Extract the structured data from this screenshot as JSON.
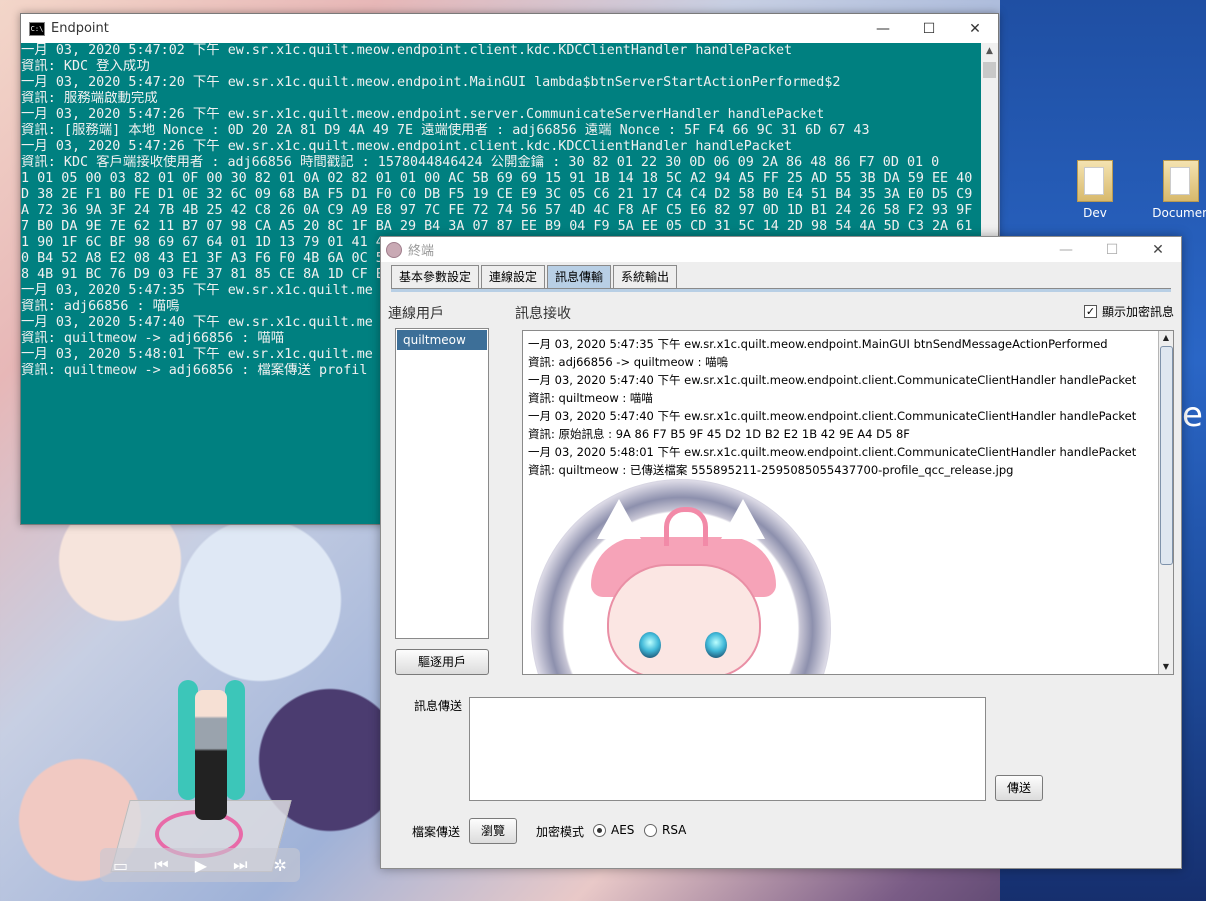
{
  "console": {
    "title": "Endpoint",
    "lines": [
      "一月 03, 2020 5:47:02 下午 ew.sr.x1c.quilt.meow.endpoint.client.kdc.KDCClientHandler handlePacket",
      "資訊: KDC 登入成功",
      "一月 03, 2020 5:47:20 下午 ew.sr.x1c.quilt.meow.endpoint.MainGUI lambda$btnServerStartActionPerformed$2",
      "資訊: 服務端啟動完成",
      "一月 03, 2020 5:47:26 下午 ew.sr.x1c.quilt.meow.endpoint.server.CommunicateServerHandler handlePacket",
      "資訊: [服務端] 本地 Nonce : 0D 20 2A 81 D9 4A 49 7E 遠端使用者 : adj66856 遠端 Nonce : 5F F4 66 9C 31 6D 67 43",
      "一月 03, 2020 5:47:26 下午 ew.sr.x1c.quilt.meow.endpoint.client.kdc.KDCClientHandler handlePacket",
      "資訊: KDC 客戶端接收使用者 : adj66856 時間戳記 : 1578044846424 公開金鑰 : 30 82 01 22 30 0D 06 09 2A 86 48 86 F7 0D 01 0",
      "1 01 05 00 03 82 01 0F 00 30 82 01 0A 02 82 01 01 00 AC 5B 69 69 15 91 1B 14 18 5C A2 94 A5 FF 25 AD 55 3B DA 59 EE 40 7",
      "D 38 2E F1 B0 FE D1 0E 32 6C 09 68 BA F5 D1 F0 C0 DB F5 19 CE E9 3C 05 C6 21 17 C4 C4 D2 58 B0 E4 51 B4 35 3A E0 D5 C9 D",
      "A 72 36 9A 3F 24 7B 4B 25 42 C8 26 0A C9 A9 E8 97 7C FE 72 74 56 57 4D 4C F8 AF C5 E6 82 97 0D 1D B1 24 26 58 F2 93 9F 1",
      "7 B0 DA 9E 7E 62 11 B7 07 98 CA A5 20 8C 1F BA 29 B4 3A 07 87 EE B9 04 F9 5A EE 05 CD 31 5C 14 2D 98 54 4A 5D C3 2A 61 8",
      "1 90 1F 6C BF 98 69 67 64 01 1D 13 79 01 41 4",
      "0 B4 52 A8 E2 08 43 E1 3F A3 F6 F0 4B 6A 0C 5",
      "8 4B 91 BC 76 D9 03 FE 37 81 85 CE 8A 1D CF E",
      "一月 03, 2020 5:47:35 下午 ew.sr.x1c.quilt.me",
      "資訊: adj66856 : 喵嗚",
      "一月 03, 2020 5:47:40 下午 ew.sr.x1c.quilt.me",
      "資訊: quiltmeow -> adj66856 : 喵喵",
      "一月 03, 2020 5:48:01 下午 ew.sr.x1c.quilt.me",
      "資訊: quiltmeow -> adj66856 : 檔案傳送 profil"
    ]
  },
  "desktop": {
    "icons": [
      "Dev",
      "Documen"
    ],
    "partial_text": "e"
  },
  "window": {
    "title": "終端",
    "tabs": [
      "基本參數設定",
      "連線設定",
      "訊息傳輸",
      "系統輸出"
    ],
    "active_tab": "訊息傳輸",
    "users_label": "連線用戶",
    "users": [
      "quiltmeow"
    ],
    "kick_button": "驅逐用戶",
    "receive_label": "訊息接收",
    "show_encrypted_label": "顯示加密訊息",
    "show_encrypted_checked": true,
    "messages": [
      "一月 03, 2020 5:47:35 下午 ew.sr.x1c.quilt.meow.endpoint.MainGUI btnSendMessageActionPerformed",
      "資訊: adj66856 -> quiltmeow : 喵嗚",
      "一月 03, 2020 5:47:40 下午 ew.sr.x1c.quilt.meow.endpoint.client.CommunicateClientHandler handlePacket",
      "資訊: quiltmeow : 喵喵",
      "一月 03, 2020 5:47:40 下午 ew.sr.x1c.quilt.meow.endpoint.client.CommunicateClientHandler handlePacket",
      "資訊: 原始訊息 : 9A 86 F7 B5 9F 45 D2 1D B2 E2 1B 42 9E A4 D5 8F",
      "一月 03, 2020 5:48:01 下午 ew.sr.x1c.quilt.meow.endpoint.client.CommunicateClientHandler handlePacket",
      "資訊: quiltmeow : 已傳送檔案 555895211-2595085055437700-profile_qcc_release.jpg"
    ],
    "send_label": "訊息傳送",
    "send_button": "傳送",
    "file_label": "檔案傳送",
    "browse_button": "瀏覽",
    "encryption_label": "加密模式",
    "encryption_options": [
      "AES",
      "RSA"
    ],
    "encryption_selected": "AES"
  }
}
